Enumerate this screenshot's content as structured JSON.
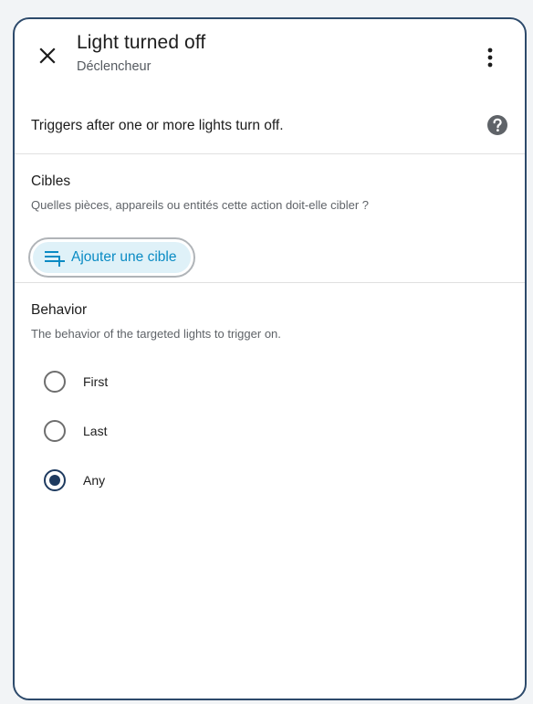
{
  "dialog": {
    "title": "Light turned off",
    "subtitle": "Déclencheur",
    "description": "Triggers after one or more lights turn off."
  },
  "targets": {
    "title": "Cibles",
    "description": "Quelles pièces, appareils ou entités cette action doit-elle cibler ?",
    "add_button_label": "Ajouter une cible"
  },
  "behavior": {
    "title": "Behavior",
    "description": "The behavior of the targeted lights to trigger on.",
    "options": [
      {
        "label": "First",
        "checked": false
      },
      {
        "label": "Last",
        "checked": false
      },
      {
        "label": "Any",
        "checked": true
      }
    ],
    "selected": "Any"
  },
  "colors": {
    "accent": "#0a8bc4",
    "accent_bg": "#dff1f8",
    "radio_checked": "#1e3a5f",
    "border": "#2d4a6b"
  },
  "icons": {
    "close": "close-icon",
    "menu": "more-vert-icon",
    "help": "help-circle-icon",
    "add_target": "playlist-plus-icon"
  }
}
